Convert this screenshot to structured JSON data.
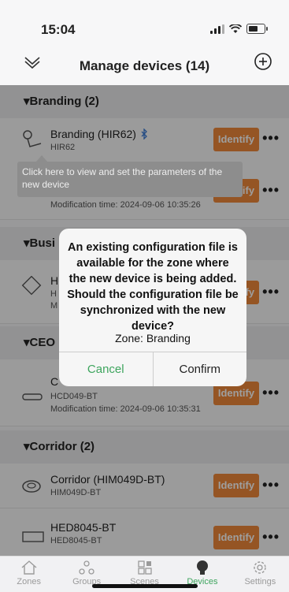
{
  "status_bar": {
    "time": "15:04"
  },
  "header": {
    "title": "Manage devices (14)"
  },
  "sections": [
    {
      "name": "▾Branding (2)"
    },
    {
      "name": "▾Busi"
    },
    {
      "name": "▾CEO"
    },
    {
      "name": "▾Corridor (2)"
    }
  ],
  "rows": [
    {
      "name": "Branding (HIR62)",
      "sub": "HIR62",
      "time": ""
    },
    {
      "name": "",
      "sub": "",
      "time": "Modification time: 2024-09-06 10:35:26"
    },
    {
      "name": "H",
      "sub": "H",
      "time": "M"
    },
    {
      "name": "C",
      "sub": "HCD049-BT",
      "time": "Modification time: 2024-09-06 10:35:31"
    },
    {
      "name": "Corridor (HIM049D-BT)",
      "sub": "HIM049D-BT",
      "time": ""
    },
    {
      "name": "HED8045-BT",
      "sub": "HED8045-BT",
      "time": ""
    }
  ],
  "identify_label": "Identify",
  "more_label": "•••",
  "tooltip": "Click here to view and set the parameters of the new device",
  "dialog": {
    "message": "An existing configuration file is available for the zone where the new device is being added. Should the configuration file be synchronized with the new device?",
    "zone": "Zone: Branding",
    "cancel": "Cancel",
    "confirm": "Confirm"
  },
  "tabs": [
    {
      "label": "Zones",
      "icon": "home-icon"
    },
    {
      "label": "Groups",
      "icon": "groups-icon"
    },
    {
      "label": "Scenes",
      "icon": "scenes-icon"
    },
    {
      "label": "Devices",
      "icon": "bulb-icon"
    },
    {
      "label": "Settings",
      "icon": "settings-icon"
    }
  ],
  "colors": {
    "accent": "#f08a3a",
    "active_tab": "#3ea55e"
  }
}
